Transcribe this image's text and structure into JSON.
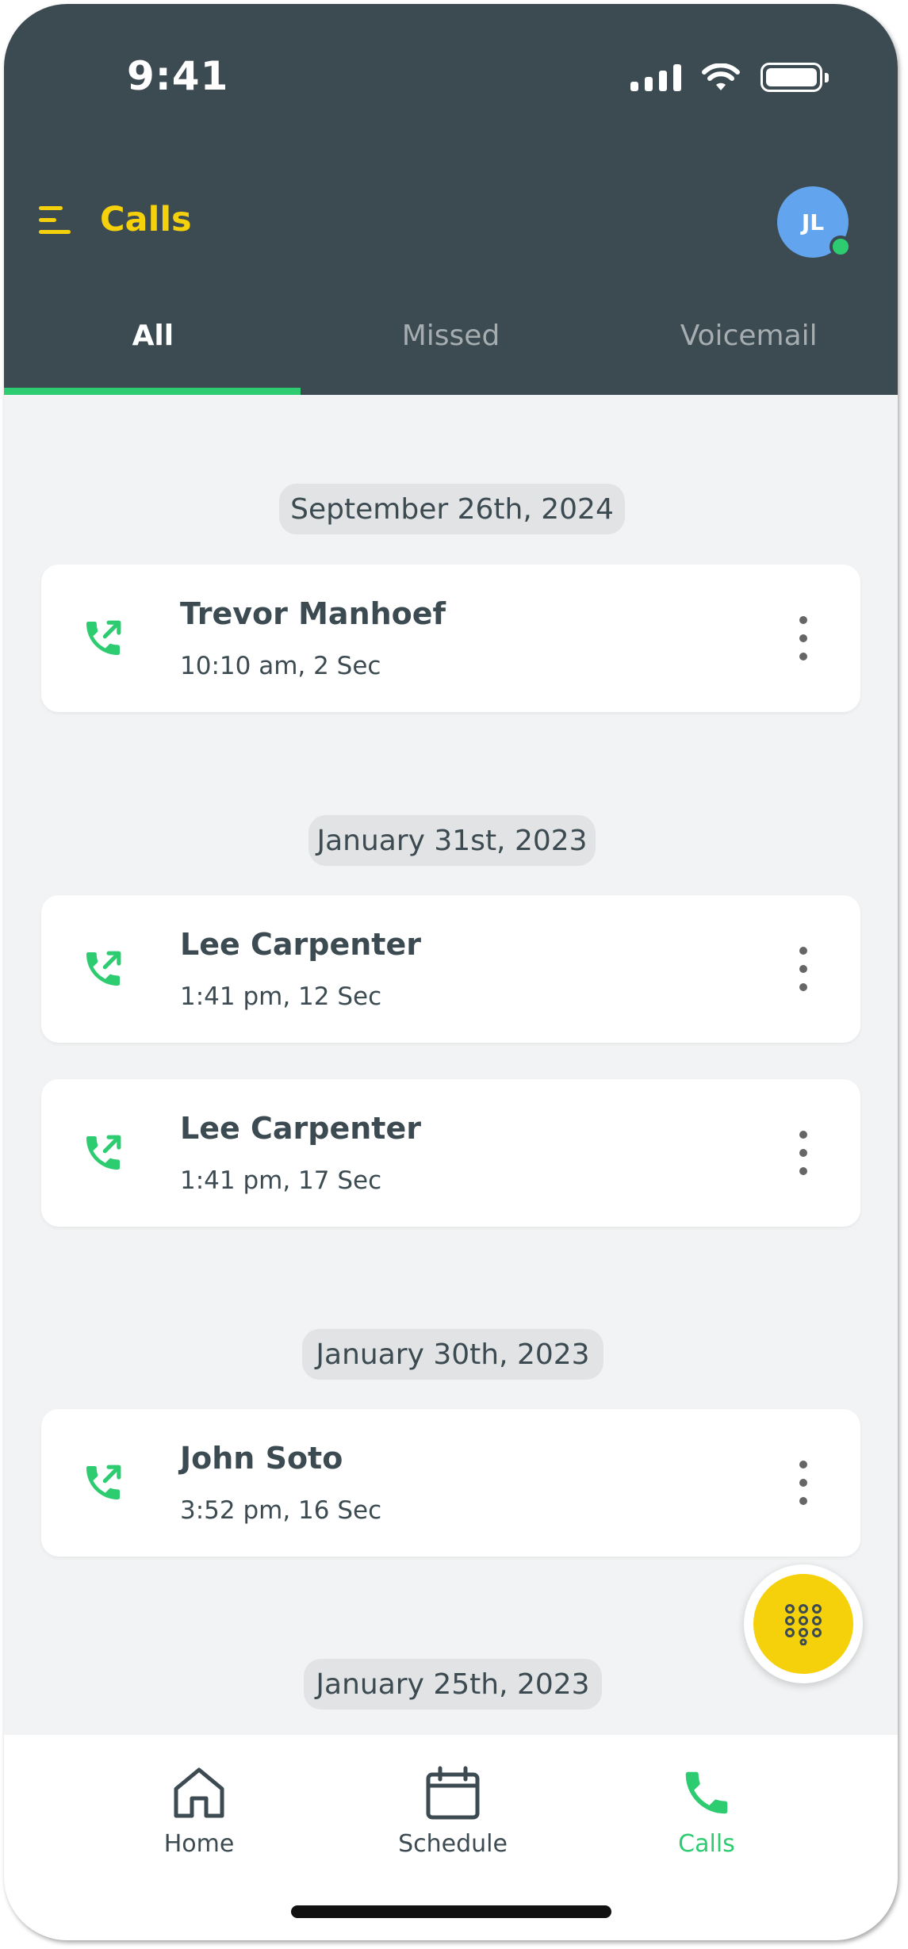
{
  "status_bar": {
    "time": "9:41"
  },
  "header": {
    "title": "Calls",
    "avatar_initials": "JL"
  },
  "tabs": [
    {
      "label": "All",
      "active": true
    },
    {
      "label": "Missed",
      "active": false
    },
    {
      "label": "Voicemail",
      "active": false
    }
  ],
  "groups": [
    {
      "date": "September 26th, 2024",
      "calls": [
        {
          "name": "Trevor Manhoef",
          "meta": "10:10 am, 2 Sec"
        }
      ]
    },
    {
      "date": "January 31st, 2023",
      "calls": [
        {
          "name": "Lee Carpenter",
          "meta": "1:41 pm, 12 Sec"
        },
        {
          "name": "Lee Carpenter",
          "meta": "1:41 pm, 17 Sec"
        }
      ]
    },
    {
      "date": "January 30th, 2023",
      "calls": [
        {
          "name": "John Soto",
          "meta": "3:52 pm, 16 Sec"
        }
      ]
    },
    {
      "date": "January 25th, 2023",
      "calls": []
    }
  ],
  "bottom_nav": [
    {
      "label": "Home",
      "icon": "home-icon",
      "active": false
    },
    {
      "label": "Schedule",
      "icon": "calendar-icon",
      "active": false
    },
    {
      "label": "Calls",
      "icon": "phone-icon",
      "active": true
    }
  ],
  "colors": {
    "header_bg": "#3c4a51",
    "accent_yellow": "#f5d10b",
    "accent_green": "#2ecc71",
    "avatar_blue": "#63a4ee",
    "list_bg": "#f1f3f4"
  }
}
